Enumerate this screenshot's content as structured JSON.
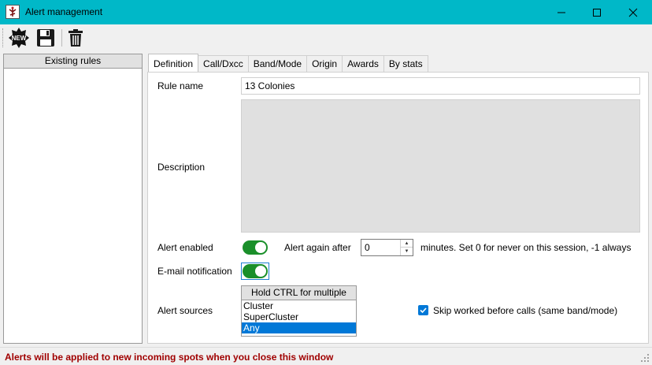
{
  "window": {
    "title": "Alert management",
    "accent_color": "#00b8c8"
  },
  "toolbar": {
    "new_label": "NEW",
    "save_icon": "save-icon",
    "delete_icon": "trash-icon"
  },
  "rules_list": {
    "header": "Existing rules",
    "items": []
  },
  "tabs": [
    {
      "label": "Definition",
      "active": true
    },
    {
      "label": "Call/Dxcc",
      "active": false
    },
    {
      "label": "Band/Mode",
      "active": false
    },
    {
      "label": "Origin",
      "active": false
    },
    {
      "label": "Awards",
      "active": false
    },
    {
      "label": "By stats",
      "active": false
    }
  ],
  "definition": {
    "rule_name_label": "Rule name",
    "rule_name_value": "13 Colonies",
    "description_label": "Description",
    "description_value": "",
    "alert_enabled_label": "Alert enabled",
    "alert_enabled": true,
    "alert_again_label": "Alert again after",
    "alert_again_value": "0",
    "minutes_note": "minutes. Set 0 for never on this session, -1 always",
    "email_label": "E-mail notification",
    "email_enabled": true,
    "sources_label": "Alert sources",
    "sources_header": "Hold CTRL for multiple",
    "sources": [
      {
        "label": "Cluster",
        "selected": false
      },
      {
        "label": "SuperCluster",
        "selected": false
      },
      {
        "label": "Any",
        "selected": true
      }
    ],
    "skip_worked_label": "Skip worked before calls (same band/mode)",
    "skip_worked_checked": true,
    "toggle_on_color": "#1a8f2a"
  },
  "status": {
    "text": "Alerts will be applied to new incoming spots when you close this window",
    "color": "#a00000"
  }
}
